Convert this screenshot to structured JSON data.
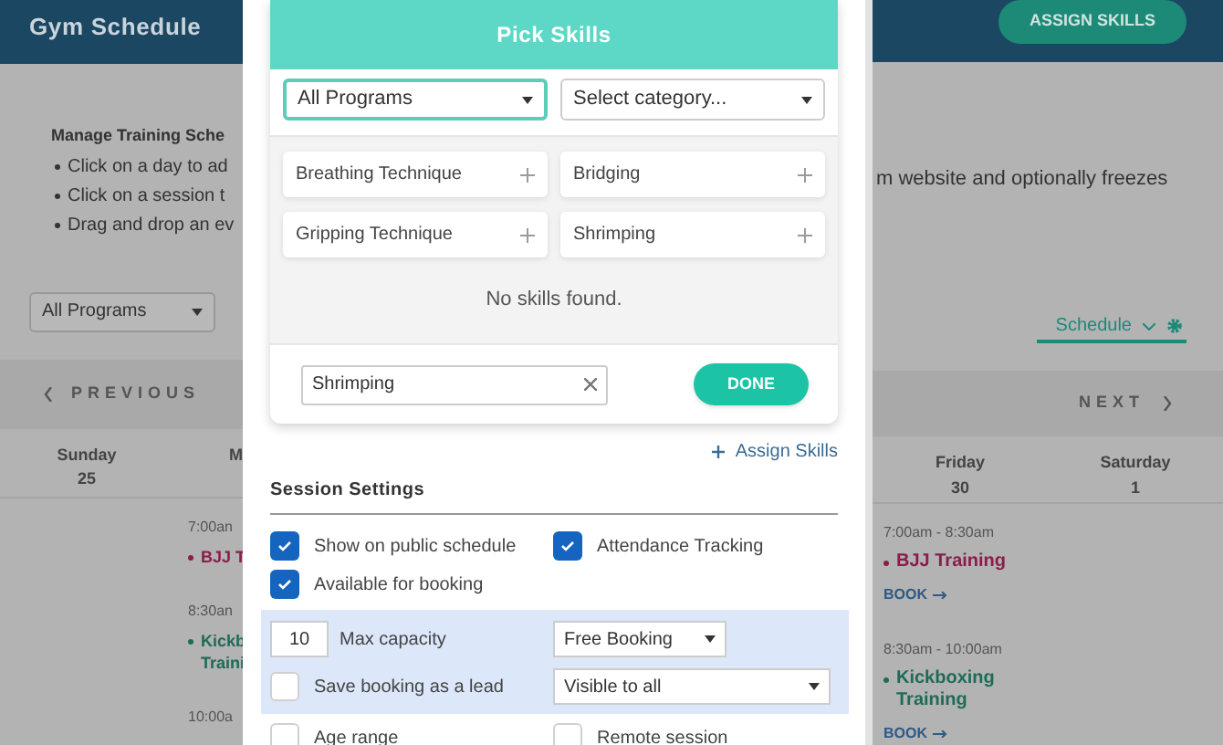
{
  "background": {
    "title": "Gym Schedule",
    "assign_button": "ASSIGN SKILLS",
    "instructions": {
      "heading": "Manage Training Sche",
      "bullets": [
        "Click on a day to ad",
        "Click on a session t",
        "Drag and drop an ev"
      ],
      "tail": "m website and optionally freezes"
    },
    "program_filter": "All Programs",
    "view_select": "Schedule",
    "nav": {
      "previous": "PREVIOUS",
      "next": "NEXT"
    },
    "days_left": [
      {
        "name": "Sunday",
        "date": "25"
      },
      {
        "name": "M"
      }
    ],
    "days_right": [
      {
        "name": "Friday",
        "date": "30"
      },
      {
        "name": "Saturday",
        "date": "1"
      }
    ],
    "monday_sessions": [
      {
        "time": "7:00an",
        "title": "BJJ T",
        "color": "#8a1d4b"
      },
      {
        "time": "8:30an",
        "title": "Kickb",
        "title_2": "Traini",
        "color": "#1e6b58"
      },
      {
        "time": "10:00a"
      }
    ],
    "friday_sessions": [
      {
        "time": "7:00am - 8:30am",
        "title": "BJJ Training",
        "color": "#8a1d4b",
        "book": "BOOK"
      },
      {
        "time": "8:30am - 10:00am",
        "title": "Kickboxing",
        "title_2": "Training",
        "color": "#1e6b58",
        "book": "BOOK"
      }
    ]
  },
  "pick_skills": {
    "title": "Pick Skills",
    "program_select": "All Programs",
    "category_select": "Select category...",
    "skills": [
      "Breathing Technique",
      "Bridging",
      "Gripping Technique",
      "Shrimping"
    ],
    "empty_message": "No skills found.",
    "search": {
      "value": "Shrimping"
    },
    "done_button": "DONE"
  },
  "assign_skills_link": "Assign Skills",
  "session_settings": {
    "title": "Session Settings",
    "options": [
      {
        "label": "Show on public schedule",
        "checked": true
      },
      {
        "label": "Attendance Tracking",
        "checked": true
      },
      {
        "label": "Available for booking",
        "checked": true
      }
    ],
    "booking": {
      "capacity": "10",
      "capacity_label": "Max capacity",
      "booking_type": "Free Booking",
      "save_lead": {
        "label": "Save booking as a lead",
        "checked": false
      },
      "visibility": "Visible to all"
    },
    "more_options": [
      {
        "label": "Age range",
        "checked": false
      },
      {
        "label": "Remote session",
        "checked": false
      }
    ]
  }
}
